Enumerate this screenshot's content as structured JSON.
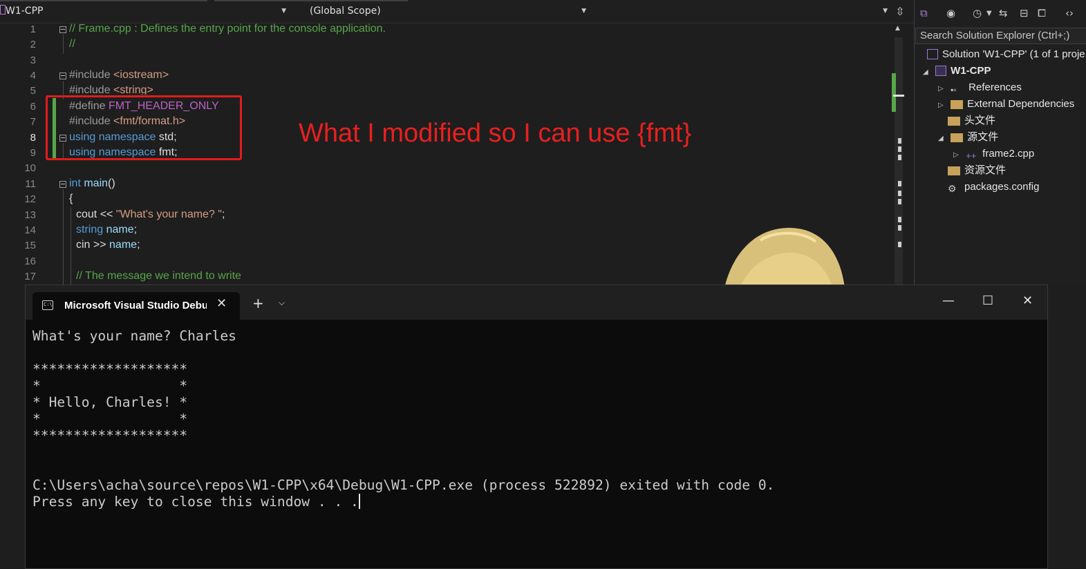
{
  "navbar": {
    "project": "W1-CPP",
    "scope": "(Global Scope)",
    "member": ""
  },
  "editor": {
    "lines": [
      {
        "n": "1",
        "text": "// Frame.cpp : Defines the entry point for the console application."
      },
      {
        "n": "2",
        "text": "//"
      },
      {
        "n": "3",
        "text": ""
      },
      {
        "n": "4",
        "pp": "#include ",
        "inc": "<iostream>"
      },
      {
        "n": "5",
        "pp": "#include ",
        "inc": "<string>"
      },
      {
        "n": "6",
        "pp": "#define ",
        "mac": "FMT_HEADER_ONLY"
      },
      {
        "n": "7",
        "pp": "#include ",
        "inc": "<fmt/format.h>"
      },
      {
        "n": "8",
        "kw": "using namespace ",
        "id": "std",
        "end": ";"
      },
      {
        "n": "9",
        "kw": "using namespace ",
        "id": "fmt",
        "end": ";"
      },
      {
        "n": "10",
        "text": ""
      },
      {
        "n": "11",
        "kw": "int ",
        "id": "main",
        "end": "()"
      },
      {
        "n": "12",
        "text": "{"
      },
      {
        "n": "13",
        "pre": "cout << ",
        "str": "\"What's your name? \"",
        "end": ";"
      },
      {
        "n": "14",
        "kw": "string ",
        "id": "name",
        "end": ";"
      },
      {
        "n": "15",
        "pre": "cin >> ",
        "id": "name",
        "end": ";"
      },
      {
        "n": "16",
        "text": ""
      },
      {
        "n": "17",
        "text": "// The message we intend to write"
      }
    ],
    "annotation": "What I modified so I can use {fmt}"
  },
  "solution_explorer": {
    "search_placeholder": "Search Solution Explorer (Ctrl+;)",
    "solution": "Solution 'W1-CPP' (1 of 1 proje",
    "project": "W1-CPP",
    "items": [
      {
        "label": "References",
        "icon": "references-icon"
      },
      {
        "label": "External Dependencies",
        "icon": "folder-icon"
      },
      {
        "label": "头文件",
        "icon": "folder-icon"
      },
      {
        "label": "源文件",
        "icon": "folder-icon"
      },
      {
        "label": "frame2.cpp",
        "icon": "cpp-file-icon"
      },
      {
        "label": "资源文件",
        "icon": "folder-icon"
      },
      {
        "label": "packages.config",
        "icon": "config-file-icon"
      }
    ]
  },
  "console": {
    "tab_title": "Microsoft Visual Studio Debug Console",
    "output": "What's your name? Charles\n\n*******************\n*                 *\n* Hello, Charles! *\n*                 *\n*******************\n\n\nC:\\Users\\acha\\source\\repos\\W1-CPP\\x64\\Debug\\W1-CPP.exe (process 522892) exited with code 0.\nPress any key to close this window . . ."
  },
  "colors": {
    "editor_bg": "#1e1e1e",
    "comment": "#57a64a",
    "keyword": "#569cd6",
    "string": "#d69d85",
    "annotation_red": "#e8201f",
    "console_bg": "#0c0c0c"
  }
}
